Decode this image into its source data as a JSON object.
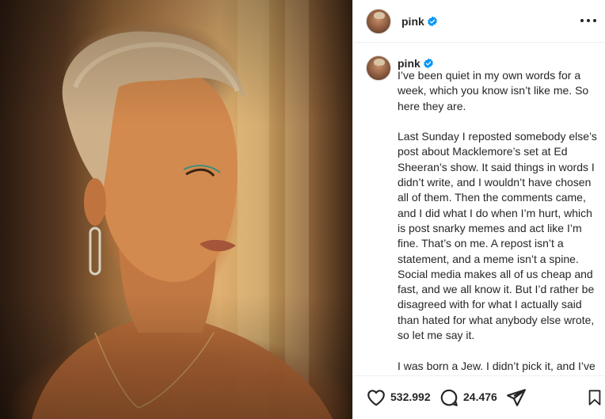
{
  "post": {
    "username": "pink",
    "photo_alt": "Portrait of a woman with short blond hair in golden light"
  },
  "caption": {
    "username": "pink",
    "paragraphs": [
      "I’ve been quiet in my own words for a week, which you know isn’t like me. So here they are.",
      "Last Sunday I reposted somebody else’s post about Macklemore’s set at Ed Sheeran’s show. It said things in words I didn’t write, and I wouldn’t have chosen all of them. Then the comments came, and I did what I do when I’m hurt, which is post snarky memes and act like I’m fine. That’s on me. A repost isn’t a statement, and a meme isn’t a spine. Social media makes all of us cheap and fast, and we all know it. But I’d rather be disagreed with for what I actually said than hated for what anybody else wrote, so let me say it.",
      "I was born a Jew. I didn’t pick it, and I’ve never hidden it. And this week a whole lot of people decided what I"
    ]
  },
  "actions": {
    "likes": "532.992",
    "comments": "24.476"
  },
  "colors": {
    "verified": "#0095f6",
    "text": "#262626"
  }
}
